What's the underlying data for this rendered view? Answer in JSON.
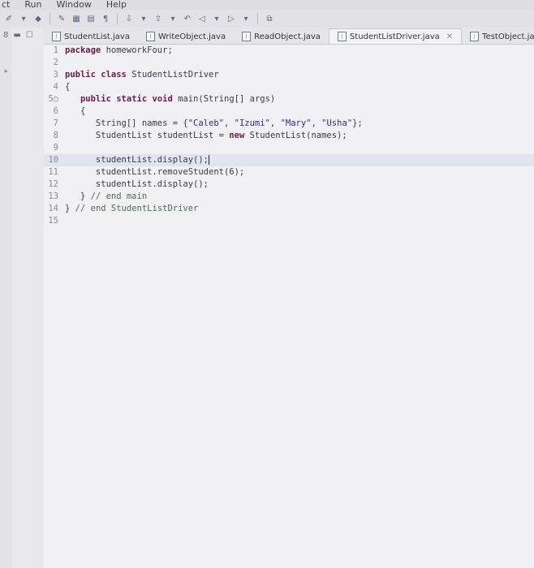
{
  "menu": [
    "ct",
    "Run",
    "Window",
    "Help"
  ],
  "tabs": [
    {
      "label": "StudentList.java",
      "active": false
    },
    {
      "label": "WriteObject.java",
      "active": false
    },
    {
      "label": "ReadObject.java",
      "active": false
    },
    {
      "label": "StudentListDriver.java",
      "active": true
    },
    {
      "label": "TestObject.java",
      "active": false
    }
  ],
  "editor": {
    "highlight_line": 10,
    "lines": [
      {
        "n": "1",
        "parts": [
          [
            "kw",
            "package"
          ],
          [
            "t",
            " homeworkFour;"
          ]
        ]
      },
      {
        "n": "2",
        "parts": []
      },
      {
        "n": "3",
        "parts": [
          [
            "kw",
            "public"
          ],
          [
            "t",
            " "
          ],
          [
            "kw",
            "class"
          ],
          [
            "t",
            " StudentListDriver"
          ]
        ]
      },
      {
        "n": "4",
        "parts": [
          [
            "t",
            "{"
          ]
        ]
      },
      {
        "n": "5○",
        "parts": [
          [
            "t",
            "   "
          ],
          [
            "kw",
            "public"
          ],
          [
            "t",
            " "
          ],
          [
            "kw",
            "static"
          ],
          [
            "t",
            " "
          ],
          [
            "kw",
            "void"
          ],
          [
            "t",
            " main(String[] args)"
          ]
        ]
      },
      {
        "n": "6",
        "parts": [
          [
            "t",
            "   {"
          ]
        ]
      },
      {
        "n": "7",
        "parts": [
          [
            "t",
            "      String[] names = {"
          ],
          [
            "str",
            "\"Caleb\""
          ],
          [
            "t",
            ", "
          ],
          [
            "str",
            "\"Izumi\""
          ],
          [
            "t",
            ", "
          ],
          [
            "str",
            "\"Mary\""
          ],
          [
            "t",
            ", "
          ],
          [
            "str",
            "\"Usha\""
          ],
          [
            "t",
            "};"
          ]
        ]
      },
      {
        "n": "8",
        "parts": [
          [
            "t",
            "      StudentList studentList = "
          ],
          [
            "kw",
            "new"
          ],
          [
            "t",
            " StudentList(names);"
          ]
        ]
      },
      {
        "n": "9",
        "parts": []
      },
      {
        "n": "10",
        "parts": [
          [
            "t",
            "      studentList.display();"
          ],
          [
            "caret",
            ""
          ]
        ]
      },
      {
        "n": "11",
        "parts": [
          [
            "t",
            "      studentList.removeStudent(6);"
          ]
        ]
      },
      {
        "n": "12",
        "parts": [
          [
            "t",
            "      studentList.display();"
          ]
        ]
      },
      {
        "n": "13",
        "parts": [
          [
            "t",
            "   } "
          ],
          [
            "cmt",
            "// end main"
          ]
        ]
      },
      {
        "n": "14",
        "parts": [
          [
            "t",
            "} "
          ],
          [
            "cmt",
            "// end StudentListDriver"
          ]
        ]
      },
      {
        "n": "15",
        "parts": []
      }
    ]
  }
}
